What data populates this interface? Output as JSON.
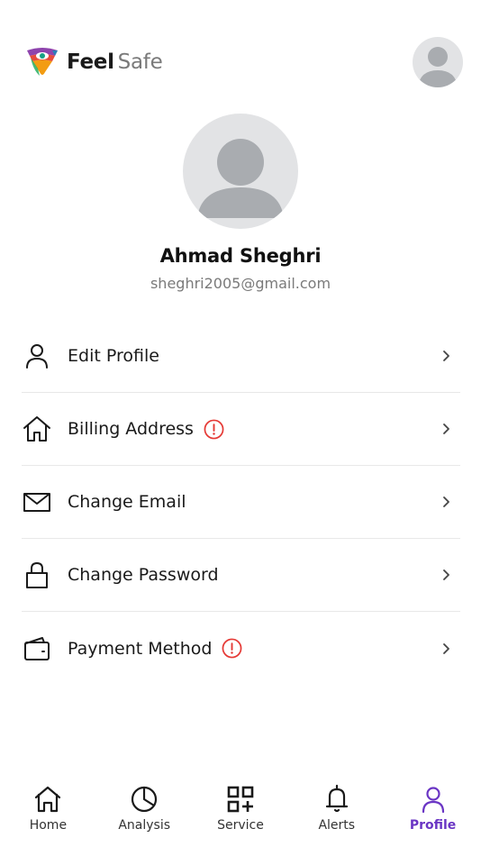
{
  "app": {
    "brand_primary": "Feel",
    "brand_secondary": "Safe"
  },
  "profile": {
    "name": "Ahmad Sheghri",
    "email": "sheghri2005@gmail.com"
  },
  "menu": {
    "items": [
      {
        "label": "Edit Profile",
        "icon": "user-icon",
        "warning": false
      },
      {
        "label": "Billing Address",
        "icon": "home-icon",
        "warning": true
      },
      {
        "label": "Change Email",
        "icon": "mail-icon",
        "warning": false
      },
      {
        "label": "Change Password",
        "icon": "lock-icon",
        "warning": false
      },
      {
        "label": "Payment Method",
        "icon": "wallet-icon",
        "warning": true
      }
    ]
  },
  "nav": {
    "items": [
      {
        "label": "Home",
        "icon": "home-icon",
        "active": false
      },
      {
        "label": "Analysis",
        "icon": "pie-chart-icon",
        "active": false
      },
      {
        "label": "Service",
        "icon": "grid-plus-icon",
        "active": false
      },
      {
        "label": "Alerts",
        "icon": "bell-icon",
        "active": false
      },
      {
        "label": "Profile",
        "icon": "user-icon",
        "active": true
      }
    ]
  },
  "colors": {
    "accent": "#6a35c4",
    "warning": "#e53935",
    "text": "#1a1a1a",
    "muted": "#7a7a7a",
    "avatar_bg": "#e2e3e5",
    "avatar_fg": "#a9acb0"
  }
}
